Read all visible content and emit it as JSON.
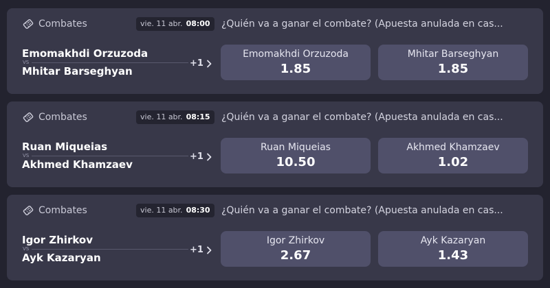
{
  "colors": {
    "page_background": "#23232f",
    "card_background": "#383849",
    "odd_button_background": "#50506a",
    "badge_background": "#242430"
  },
  "events": [
    {
      "sport": "Combates",
      "sport_icon": "ticket-icon",
      "date": "vie. 11 abr.",
      "time": "08:00",
      "question": "¿Quién va a ganar el combate? (Apuesta anulada en cas...",
      "home": "Emomakhdi Orzuzoda",
      "vs": "VS",
      "away": "Mhitar Barseghyan",
      "more_markets": "+1",
      "odds": [
        {
          "name": "Emomakhdi Orzuzoda",
          "value": "1.85"
        },
        {
          "name": "Mhitar Barseghyan",
          "value": "1.85"
        }
      ]
    },
    {
      "sport": "Combates",
      "sport_icon": "ticket-icon",
      "date": "vie. 11 abr.",
      "time": "08:15",
      "question": "¿Quién va a ganar el combate? (Apuesta anulada en cas...",
      "home": "Ruan Miqueias",
      "vs": "VS",
      "away": "Akhmed Khamzaev",
      "more_markets": "+1",
      "odds": [
        {
          "name": "Ruan Miqueias",
          "value": "10.50"
        },
        {
          "name": "Akhmed Khamzaev",
          "value": "1.02"
        }
      ]
    },
    {
      "sport": "Combates",
      "sport_icon": "ticket-icon",
      "date": "vie. 11 abr.",
      "time": "08:30",
      "question": "¿Quién va a ganar el combate? (Apuesta anulada en cas...",
      "home": "Igor Zhirkov",
      "vs": "VS",
      "away": "Ayk Kazaryan",
      "more_markets": "+1",
      "odds": [
        {
          "name": "Igor Zhirkov",
          "value": "2.67"
        },
        {
          "name": "Ayk Kazaryan",
          "value": "1.43"
        }
      ]
    }
  ]
}
